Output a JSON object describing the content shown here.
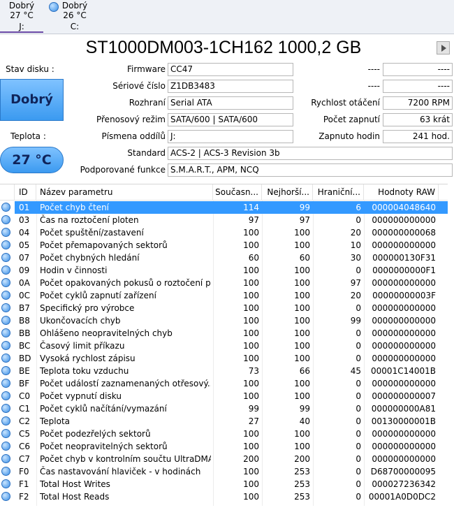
{
  "drive_tabs": [
    {
      "status": "Dobrý",
      "temp": "27 °C",
      "letter": "J:",
      "active": true
    },
    {
      "status": "Dobrý",
      "temp": "26 °C",
      "letter": "C:",
      "active": false
    }
  ],
  "disk_title": "ST1000DM003-1CH162 1000,2 GB",
  "status": {
    "label": "Stav disku :",
    "value": "Dobrý"
  },
  "temperature": {
    "label": "Teplota :",
    "value": "27 °C"
  },
  "info": {
    "firmware": {
      "label": "Firmware",
      "value": "CC47"
    },
    "serial": {
      "label": "Sériové číslo",
      "value": "Z1DB3483"
    },
    "interface": {
      "label": "Rozhraní",
      "value": "Serial ATA"
    },
    "transfer_mode": {
      "label": "Přenosový režim",
      "value": "SATA/600 | SATA/600"
    },
    "drive_letters": {
      "label": "Písmena oddílů",
      "value": "J:"
    },
    "standard": {
      "label": "Standard",
      "value": "ACS-2 | ACS-3 Revision 3b"
    },
    "features": {
      "label": "Podporované funkce",
      "value": "S.M.A.R.T., APM, NCQ"
    },
    "blank1": {
      "label": "----",
      "value": "----"
    },
    "blank2": {
      "label": "----",
      "value": "----"
    },
    "rotation": {
      "label": "Rychlost otáčení",
      "value": "7200 RPM"
    },
    "power_on_count": {
      "label": "Počet zapnutí",
      "value": "63 krát"
    },
    "power_on_hours": {
      "label": "Zapnuto hodin",
      "value": "241 hod."
    }
  },
  "columns": {
    "id": "ID",
    "name": "Název parametru",
    "current": "Současn...",
    "worst": "Nejhorší...",
    "threshold": "Hraniční...",
    "raw": "Hodnoty RAW"
  },
  "rows": [
    {
      "id": "01",
      "name": "Počet chyb čtení",
      "current": "114",
      "worst": "99",
      "threshold": "6",
      "raw": "000004048640"
    },
    {
      "id": "03",
      "name": "Čas na roztočení ploten",
      "current": "97",
      "worst": "97",
      "threshold": "0",
      "raw": "000000000000"
    },
    {
      "id": "04",
      "name": "Počet spuštění/zastavení",
      "current": "100",
      "worst": "100",
      "threshold": "20",
      "raw": "000000000068"
    },
    {
      "id": "05",
      "name": "Počet přemapovaných sektorů",
      "current": "100",
      "worst": "100",
      "threshold": "10",
      "raw": "000000000000"
    },
    {
      "id": "07",
      "name": "Počet chybných hledání",
      "current": "60",
      "worst": "60",
      "threshold": "30",
      "raw": "000000130F31"
    },
    {
      "id": "09",
      "name": "Hodin v činnosti",
      "current": "100",
      "worst": "100",
      "threshold": "0",
      "raw": "0000000000F1"
    },
    {
      "id": "0A",
      "name": "Počet opakovaných pokusů o roztočení p...",
      "current": "100",
      "worst": "100",
      "threshold": "97",
      "raw": "000000000000"
    },
    {
      "id": "0C",
      "name": "Počet cyklů zapnutí zařízení",
      "current": "100",
      "worst": "100",
      "threshold": "20",
      "raw": "00000000003F"
    },
    {
      "id": "B7",
      "name": "Specifický pro výrobce",
      "current": "100",
      "worst": "100",
      "threshold": "0",
      "raw": "000000000000"
    },
    {
      "id": "B8",
      "name": "Ukončovacích chyb",
      "current": "100",
      "worst": "100",
      "threshold": "99",
      "raw": "000000000000"
    },
    {
      "id": "BB",
      "name": "Ohlášeno neopravitelných chyb",
      "current": "100",
      "worst": "100",
      "threshold": "0",
      "raw": "000000000000"
    },
    {
      "id": "BC",
      "name": "Časový limit příkazu",
      "current": "100",
      "worst": "100",
      "threshold": "0",
      "raw": "000000000000"
    },
    {
      "id": "BD",
      "name": "Vysoká rychlost zápisu",
      "current": "100",
      "worst": "100",
      "threshold": "0",
      "raw": "000000000000"
    },
    {
      "id": "BE",
      "name": "Teplota toku vzduchu",
      "current": "73",
      "worst": "66",
      "threshold": "45",
      "raw": "00001C14001B"
    },
    {
      "id": "BF",
      "name": "Počet událostí zaznamenaných otřesový...",
      "current": "100",
      "worst": "100",
      "threshold": "0",
      "raw": "000000000000"
    },
    {
      "id": "C0",
      "name": "Počet vypnutí disku",
      "current": "100",
      "worst": "100",
      "threshold": "0",
      "raw": "000000000007"
    },
    {
      "id": "C1",
      "name": "Počet cyklů načítání/vymazání",
      "current": "99",
      "worst": "99",
      "threshold": "0",
      "raw": "000000000A81"
    },
    {
      "id": "C2",
      "name": "Teplota",
      "current": "27",
      "worst": "40",
      "threshold": "0",
      "raw": "00130000001B"
    },
    {
      "id": "C5",
      "name": "Počet podezřelých sektorů",
      "current": "100",
      "worst": "100",
      "threshold": "0",
      "raw": "000000000000"
    },
    {
      "id": "C6",
      "name": "Počet neopravitelných sektorů",
      "current": "100",
      "worst": "100",
      "threshold": "0",
      "raw": "000000000000"
    },
    {
      "id": "C7",
      "name": "Počet chyb v kontrolním součtu UltraDMA",
      "current": "200",
      "worst": "200",
      "threshold": "0",
      "raw": "000000000000"
    },
    {
      "id": "F0",
      "name": "Čas nastavování hlaviček - v hodinách",
      "current": "100",
      "worst": "253",
      "threshold": "0",
      "raw": "D68700000095"
    },
    {
      "id": "F1",
      "name": "Total Host Writes",
      "current": "100",
      "worst": "253",
      "threshold": "0",
      "raw": "000027236342"
    },
    {
      "id": "F2",
      "name": "Total Host Reads",
      "current": "100",
      "worst": "253",
      "threshold": "0",
      "raw": "00001A0D0DC2"
    }
  ],
  "selected_row_index": 0
}
